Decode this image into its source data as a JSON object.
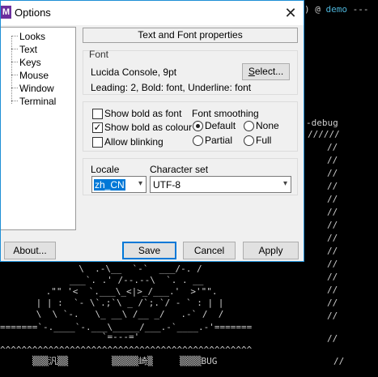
{
  "terminal": {
    "prompt_tail": ") @ ",
    "prompt_host": "demo",
    "prompt_end": " ---",
    "debug_text": "-debug",
    "slashes_top": "//////",
    "art_lines": [
      "  \\  .-\\__  `-`  ___/-. /",
      "   ___`. .' /--.--\\  `. . __",
      " .\"\" '<  `.___\\_<|>_/___.'  >'\"\".",
      " | | :  `- \\`.;`\\ _ /`;.`/ - ` : | |",
      " \\  \\ `-.   \\_ __\\ /__ _/   .-` /  /",
      "=======`-.____`-.___\\_____/___.-`____.-'=======",
      "                   `=---='"
    ],
    "carets": "^^^^^^^^^^^^^^^^^^^^^^^^^^^^^^^^^^^^^^^^^^^^^^^",
    "bottom_a": "▒▒▒汎▒▒",
    "bottom_b": "▒▒▒▒▒崎▒",
    "bottom_c": "▒▒▒▒BUG",
    "right_slash": "//"
  },
  "dialog": {
    "title": "Options",
    "app_icon_letter": "M",
    "close_glyph": "✕",
    "tree": [
      "Looks",
      "Text",
      "Keys",
      "Mouse",
      "Window",
      "Terminal"
    ],
    "header_button": "Text and Font properties",
    "font": {
      "group_label": "Font",
      "name": "Lucida Console, 9pt",
      "select_button": "Select...",
      "details": "Leading: 2, Bold: font, Underline: font"
    },
    "bold": {
      "show_bold_as_font": "Show bold as font",
      "show_bold_as_colour": "Show bold as colour",
      "allow_blinking": "Allow blinking",
      "check_mark": "✓"
    },
    "smoothing": {
      "label": "Font smoothing",
      "default": "Default",
      "none": "None",
      "partial": "Partial",
      "full": "Full"
    },
    "locale": {
      "label": "Locale",
      "value": "zh_CN"
    },
    "charset": {
      "label": "Character set",
      "value": "UTF-8"
    },
    "combo_arrow": "▾",
    "buttons": {
      "about": "About...",
      "save": "Save",
      "cancel": "Cancel",
      "apply": "Apply"
    }
  }
}
